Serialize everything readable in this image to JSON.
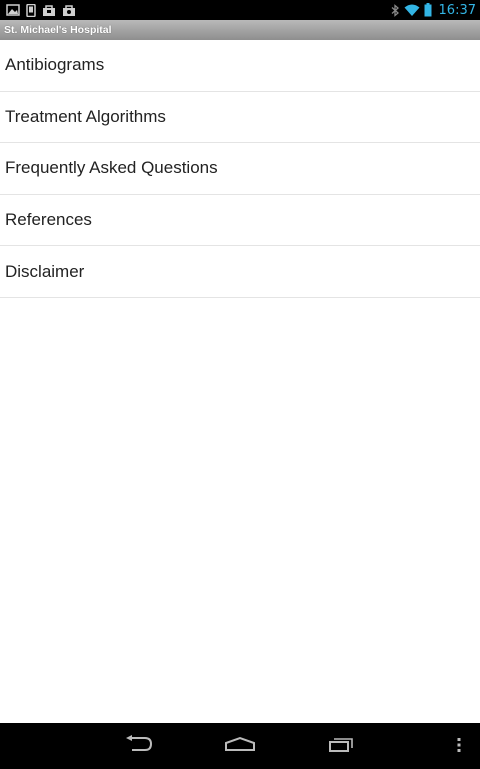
{
  "status_bar": {
    "time": "16:37",
    "left_icons": [
      "gallery-icon",
      "phone-icon",
      "shop-bag-icon",
      "camera-bag-icon"
    ],
    "right_icons": [
      "bluetooth-icon",
      "wifi-icon",
      "battery-icon"
    ],
    "accent_color": "#33b5e5"
  },
  "title_bar": {
    "title": "St. Michael's Hospital"
  },
  "menu": {
    "items": [
      {
        "label": "Antibiograms"
      },
      {
        "label": "Treatment Algorithms"
      },
      {
        "label": "Frequently Asked Questions"
      },
      {
        "label": "References"
      },
      {
        "label": "Disclaimer"
      }
    ]
  },
  "nav_bar": {
    "buttons": [
      "back-icon",
      "home-icon",
      "recent-apps-icon",
      "overflow-menu-icon"
    ]
  }
}
